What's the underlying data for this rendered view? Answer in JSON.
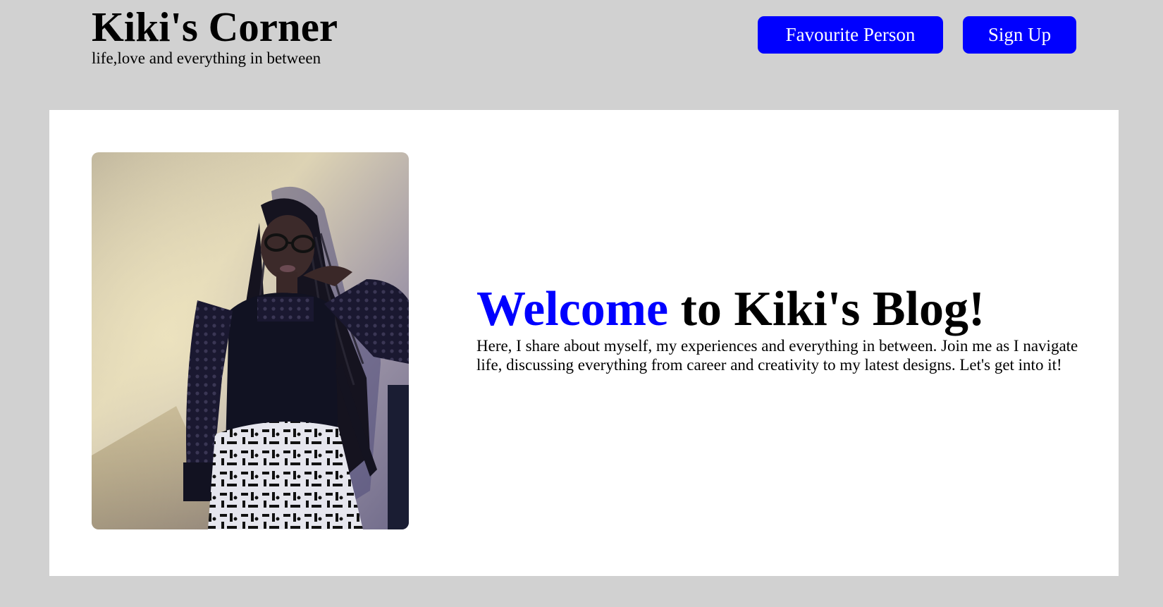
{
  "header": {
    "title": "Kiki's Corner",
    "tagline": "life,love and everything in between",
    "favourite_label": "Favourite Person",
    "signup_label": "Sign Up"
  },
  "hero": {
    "heading_accent": "Welcome",
    "heading_rest": " to Kiki's Blog!",
    "body": "Here, I share about myself, my experiences and everything in between. Join me as I navigate life, discussing everything from career and creativity to my latest designs. Let's get into it!",
    "photo_icon": "portrait-photo"
  },
  "colors": {
    "page_background": "#d1d1d1",
    "card_background": "#ffffff",
    "accent": "#0000ff",
    "button_text": "#ffffff"
  }
}
